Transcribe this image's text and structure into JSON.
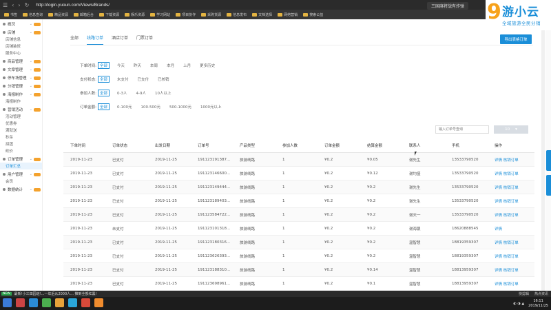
{
  "browser": {
    "url": "http://login.yuoun.com/Views/Brands/",
    "tab_title": "三国麻将战有炸弹",
    "bookmarks": [
      "书签",
      "信息查询",
      "精品资源",
      "邮箱后台",
      "下载资源",
      "娱乐资源",
      "学习网站",
      "项目协作",
      "采购货源",
      "信息发布",
      "文档选择",
      "网络营销",
      "搜索公益"
    ]
  },
  "logo": {
    "mark": "9",
    "text": "游小云",
    "sub": "全域旅游全民分销"
  },
  "sidebar": {
    "items": [
      {
        "label": "概况",
        "kind": "head"
      },
      {
        "label": "店铺",
        "kind": "head"
      },
      {
        "label": "店铺信息",
        "kind": "sub"
      },
      {
        "label": "店铺装修",
        "kind": "sub"
      },
      {
        "label": "服务中心",
        "kind": "sub"
      },
      {
        "label": "商品管理",
        "kind": "head"
      },
      {
        "label": "文章管理",
        "kind": "head"
      },
      {
        "label": "停车场管理",
        "kind": "head"
      },
      {
        "label": "分销管理",
        "kind": "head"
      },
      {
        "label": "海报制作",
        "kind": "head"
      },
      {
        "label": "海报制作",
        "kind": "sub"
      },
      {
        "label": "营销活动",
        "kind": "head"
      },
      {
        "label": "活动管理",
        "kind": "sub"
      },
      {
        "label": "优惠券",
        "kind": "sub"
      },
      {
        "label": "满就送",
        "kind": "sub"
      },
      {
        "label": "秒杀",
        "kind": "sub"
      },
      {
        "label": "拼团",
        "kind": "sub"
      },
      {
        "label": "砍价",
        "kind": "sub"
      },
      {
        "label": "订单管理",
        "kind": "head"
      },
      {
        "label": "订单汇总",
        "kind": "sub",
        "active": true
      },
      {
        "label": "用户管理",
        "kind": "head"
      },
      {
        "label": "会员",
        "kind": "sub"
      },
      {
        "label": "数据统计",
        "kind": "head"
      }
    ]
  },
  "tabs": [
    {
      "label": "全部"
    },
    {
      "label": "线路订单",
      "active": true
    },
    {
      "label": "酒店订单"
    },
    {
      "label": "门票订单"
    }
  ],
  "export_label": "导出表格订单",
  "filters": [
    {
      "label": "下单时间:",
      "options": [
        "全部",
        "今天",
        "昨天",
        "本周",
        "本月",
        "上月",
        "更多历史"
      ]
    },
    {
      "label": "支付状态:",
      "options": [
        "全部",
        "未支付",
        "已支付",
        "已核销"
      ]
    },
    {
      "label": "参加人数:",
      "options": [
        "全部",
        "0-3人",
        "4-9人",
        "10人以上"
      ]
    },
    {
      "label": "订单金额:",
      "options": [
        "全部",
        "0-100元",
        "100-500元",
        "500-1000元",
        "1000元以上"
      ]
    }
  ],
  "search_placeholder": "输入订单号查询",
  "page_size": {
    "value": "10",
    "arrow": "▾"
  },
  "table": {
    "headers": [
      "下单时间",
      "订单状态",
      "出发日期",
      "订单号",
      "产品类型",
      "参加人数",
      "订单金额",
      "结算金额",
      "联系人",
      "手机",
      "操作"
    ],
    "rows": [
      [
        "2019-11-23",
        "已支付",
        "2019-11-25",
        "191123191387...",
        "旅游线路",
        "1",
        "¥0.2",
        "¥0.05",
        "谢先生",
        "13533790520",
        "详情 核销订单"
      ],
      [
        "2019-11-23",
        "已支付",
        "2019-11-25",
        "191123146600...",
        "旅游线路",
        "1",
        "¥0.2",
        "¥0.12",
        "谢均盛",
        "13533790520",
        "详情 核销订单"
      ],
      [
        "2019-11-23",
        "已支付",
        "2019-11-25",
        "191123149444...",
        "旅游线路",
        "1",
        "¥0.2",
        "¥0.2",
        "谢先生",
        "13533790520",
        "详情 核销订单"
      ],
      [
        "2019-11-23",
        "已支付",
        "2019-11-25",
        "191123189403...",
        "旅游线路",
        "1",
        "¥0.2",
        "¥0.2",
        "谢先生",
        "13533790520",
        "详情 核销订单"
      ],
      [
        "2019-11-23",
        "已支付",
        "2019-11-25",
        "191123584722...",
        "旅游线路",
        "1",
        "¥0.2",
        "¥0.2",
        "谢天一",
        "13533790520",
        "详情 核销订单"
      ],
      [
        "2019-11-23",
        "未支付",
        "2019-11-25",
        "191123101318...",
        "旅游线路",
        "1",
        "¥0.2",
        "¥0.2",
        "谢海银",
        "18620888545",
        "详情"
      ],
      [
        "2019-11-23",
        "已支付",
        "2019-11-25",
        "191123180316...",
        "旅游线路",
        "1",
        "¥0.2",
        "¥0.2",
        "温智慧",
        "18819359307",
        "详情 核销订单"
      ],
      [
        "2019-11-23",
        "已支付",
        "2019-11-25",
        "191123626393...",
        "旅游线路",
        "1",
        "¥0.2",
        "¥0.2",
        "温智慧",
        "18819359307",
        "详情 核销订单"
      ],
      [
        "2019-11-23",
        "已支付",
        "2019-11-25",
        "191123188310...",
        "旅游线路",
        "1",
        "¥0.2",
        "¥0.14",
        "温智慧",
        "18813959307",
        "详情 核销订单"
      ],
      [
        "2019-11-23",
        "已支付",
        "2019-11-25",
        "191123698961...",
        "旅游线路",
        "1",
        "¥0.2",
        "¥0.1",
        "温智慧",
        "18813959307",
        "详情 核销订单"
      ]
    ]
  },
  "taskbar": {
    "new_tag": "NEW",
    "status_text": "最新!小三田园谜!...一年后从2000人... 推到全部红黑!",
    "status_items": [
      "快剪辑",
      "热点资讯"
    ],
    "clock_time": "16:11",
    "clock_date": "2019/11/25"
  },
  "colors": {
    "accent": "#1a8ed8",
    "logo_orange": "#f7a21b"
  }
}
